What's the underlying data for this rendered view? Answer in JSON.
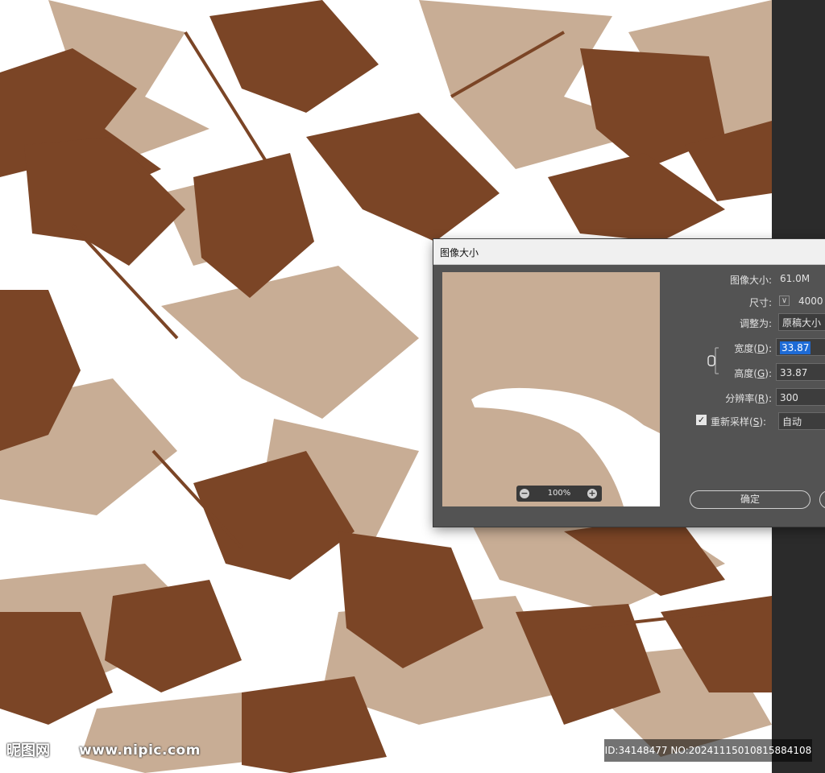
{
  "colors": {
    "leaf_dark": "#7b4526",
    "leaf_light": "#c8ad95",
    "background": "#ffffff",
    "dialog_bg": "#535353",
    "accent_selection": "#1e6bd6"
  },
  "dialog": {
    "title": "图像大小",
    "zoom": "100%",
    "image_size_label": "图像大小:",
    "image_size_value": "61.0M",
    "dimensions_label": "尺寸:",
    "dimensions_value": "4000",
    "fit_label": "调整为:",
    "fit_value": "原稿大小",
    "width_label": "宽度(",
    "width_key": "D",
    "width_value": "33.87",
    "height_label": "高度(",
    "height_key": "G",
    "height_value": "33.87",
    "resolution_label": "分辨率(",
    "resolution_key": "R",
    "resolution_value": "300",
    "resample_label": "重新采样(",
    "resample_key": "S",
    "resample_value": "自动",
    "ok_label": "确定"
  },
  "watermark": {
    "logo": "昵图网",
    "url": "www.nipic.com",
    "id": "ID:34148477 NO:20241115010815884108"
  }
}
